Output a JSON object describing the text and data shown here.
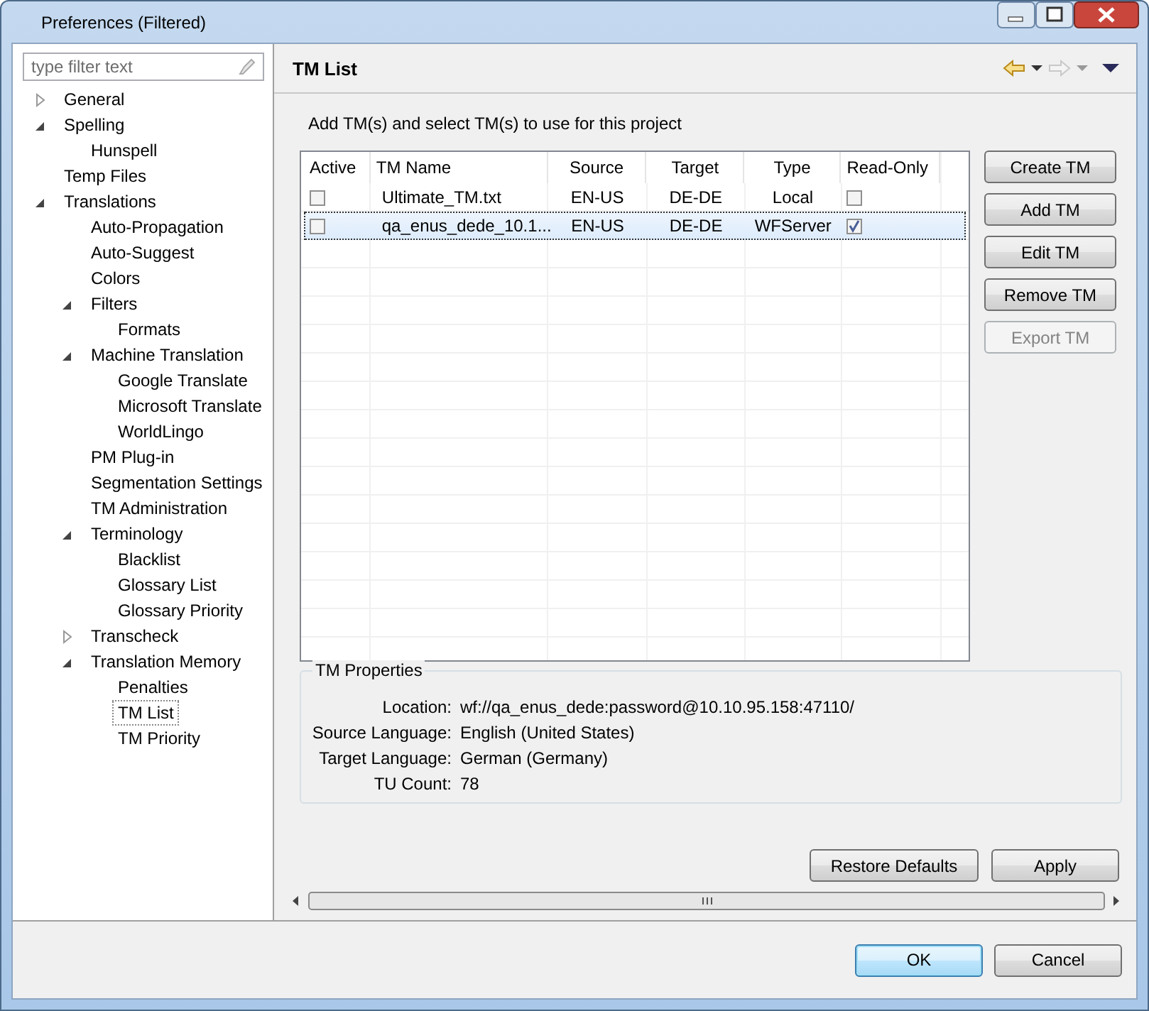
{
  "window": {
    "title": "Preferences (Filtered)"
  },
  "filter": {
    "placeholder": "type filter text"
  },
  "tree": [
    {
      "label": "General",
      "expanded": false,
      "selected": false
    },
    {
      "label": "Spelling",
      "expanded": true,
      "selected": false,
      "children": [
        {
          "label": "Hunspell",
          "selected": false
        }
      ]
    },
    {
      "label": "Temp Files",
      "selected": false
    },
    {
      "label": "Translations",
      "expanded": true,
      "selected": false,
      "children": [
        {
          "label": "Auto-Propagation",
          "selected": false
        },
        {
          "label": "Auto-Suggest",
          "selected": false
        },
        {
          "label": "Colors",
          "selected": false
        },
        {
          "label": "Filters",
          "expanded": true,
          "selected": false,
          "children": [
            {
              "label": "Formats",
              "selected": false
            }
          ]
        },
        {
          "label": "Machine Translation",
          "expanded": true,
          "selected": false,
          "children": [
            {
              "label": "Google Translate",
              "selected": false
            },
            {
              "label": "Microsoft Translate",
              "selected": false
            },
            {
              "label": "WorldLingo",
              "selected": false
            }
          ]
        },
        {
          "label": "PM Plug-in",
          "selected": false
        },
        {
          "label": "Segmentation Settings",
          "selected": false
        },
        {
          "label": "TM Administration",
          "selected": false
        },
        {
          "label": "Terminology",
          "expanded": true,
          "selected": false,
          "children": [
            {
              "label": "Blacklist",
              "selected": false
            },
            {
              "label": "Glossary List",
              "selected": false
            },
            {
              "label": "Glossary Priority",
              "selected": false
            }
          ]
        },
        {
          "label": "Transcheck",
          "expanded": false,
          "selected": false
        },
        {
          "label": "Translation Memory",
          "expanded": true,
          "selected": false,
          "children": [
            {
              "label": "Penalties",
              "selected": false
            },
            {
              "label": "TM List",
              "selected": true
            },
            {
              "label": "TM Priority",
              "selected": false
            }
          ]
        }
      ]
    }
  ],
  "page": {
    "title": "TM List",
    "description": "Add TM(s) and select TM(s) to use for this project"
  },
  "table": {
    "columns": [
      "Active",
      "TM Name",
      "Source",
      "Target",
      "Type",
      "Read-Only"
    ],
    "rows": [
      {
        "active": false,
        "name": "Ultimate_TM.txt",
        "source": "EN-US",
        "target": "DE-DE",
        "type": "Local",
        "read_only": false,
        "selected": false
      },
      {
        "active": false,
        "name": "qa_enus_dede_10.1...",
        "source": "EN-US",
        "target": "DE-DE",
        "type": "WFServer",
        "read_only": true,
        "selected": true
      }
    ]
  },
  "side_buttons": [
    {
      "label": "Create TM",
      "disabled": false
    },
    {
      "label": "Add TM",
      "disabled": false
    },
    {
      "label": "Edit TM",
      "disabled": false
    },
    {
      "label": "Remove TM",
      "disabled": false
    },
    {
      "label": "Export TM",
      "disabled": true
    }
  ],
  "properties": {
    "title": "TM Properties",
    "fields": [
      {
        "label": "Location:",
        "value": "wf://qa_enus_dede:password@10.10.95.158:47110/"
      },
      {
        "label": "Source Language:",
        "value": "English (United States)"
      },
      {
        "label": "Target Language:",
        "value": "German (Germany)"
      },
      {
        "label": "TU Count:",
        "value": "78"
      }
    ]
  },
  "page_buttons": [
    "Restore Defaults",
    "Apply"
  ],
  "dialog_buttons": [
    {
      "label": "OK",
      "default": true
    },
    {
      "label": "Cancel",
      "default": false
    }
  ]
}
